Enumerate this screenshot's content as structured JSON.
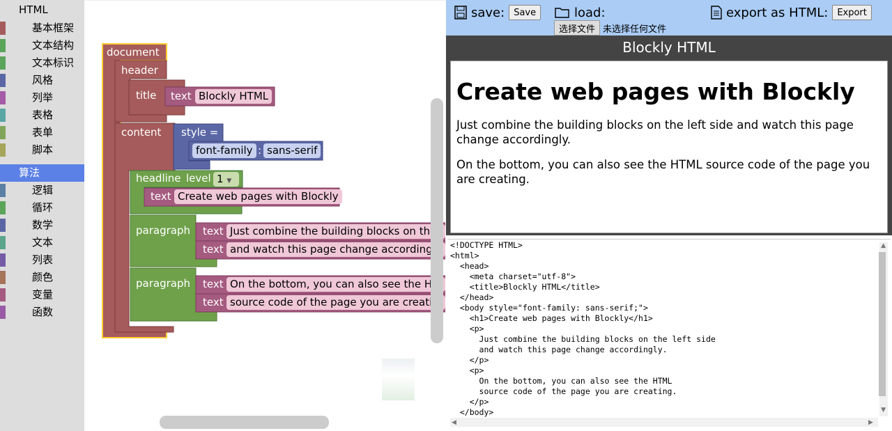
{
  "toolbox": {
    "items": [
      {
        "label": "HTML",
        "color": "",
        "type": "top"
      },
      {
        "label": "基本框架",
        "color": "#a55b5b"
      },
      {
        "label": "文本结构",
        "color": "#5ba55b"
      },
      {
        "label": "文本标识",
        "color": "#5ba55b"
      },
      {
        "label": "风格",
        "color": "#5b67a5"
      },
      {
        "label": "列举",
        "color": "#a55ba5"
      },
      {
        "label": "表格",
        "color": "#5ba5a5"
      },
      {
        "label": "表单",
        "color": "#80a55b"
      },
      {
        "label": "脚本",
        "color": "#a5a55b"
      },
      {
        "label": "算法",
        "color": "",
        "type": "selected"
      },
      {
        "label": "逻辑",
        "color": "#5b80a5"
      },
      {
        "label": "循环",
        "color": "#5ba55b"
      },
      {
        "label": "数学",
        "color": "#5b67a5"
      },
      {
        "label": "文本",
        "color": "#5ba58c"
      },
      {
        "label": "列表",
        "color": "#745ba5"
      },
      {
        "label": "颜色",
        "color": "#a5745b"
      },
      {
        "label": "变量",
        "color": "#a55b80"
      },
      {
        "label": "函数",
        "color": "#995ba5"
      }
    ]
  },
  "blocks": {
    "document": "document",
    "header": "header",
    "title": "title",
    "title_text_label": "text",
    "title_text_value": "Blockly HTML",
    "content": "content",
    "style": "style =",
    "font_family": "font-family",
    "colon": ":",
    "font_value": "sans-serif",
    "headline": "headline",
    "level_label": "level",
    "level_value": "1",
    "headline_text_label": "text",
    "headline_text_value": "Create web pages with Blockly",
    "paragraph": "paragraph",
    "p1_line1_label": "text",
    "p1_line1_value": "Just combine the building blocks on the",
    "p1_line2_label": "text",
    "p1_line2_value": "and watch this page change accordingly",
    "p2_line1_label": "text",
    "p2_line1_value": "On the bottom, you can also see the HT",
    "p2_line2_label": "text",
    "p2_line2_value": "source code of the page you are creatin"
  },
  "toolbar": {
    "save_label": "save:",
    "save_button": "Save",
    "load_label": "load:",
    "choose_file": "选择文件",
    "no_file": "未选择任何文件",
    "export_label": "export as HTML:",
    "export_button": "Export"
  },
  "panel_title": "Blockly HTML",
  "preview": {
    "heading": "Create web pages with Blockly",
    "p1": "Just combine the building blocks on the left side and watch this page change accordingly.",
    "p2": "On the bottom, you can also see the HTML source code of the page you are creating."
  },
  "source": "<!DOCTYPE HTML>\n<html>\n  <head>\n    <meta charset=\"utf-8\">\n    <title>Blockly HTML</title>\n  </head>\n  <body style=\"font-family: sans-serif;\">\n    <h1>Create web pages with Blockly</h1>\n    <p>\n      Just combine the building blocks on the left side\n      and watch this page change accordingly.\n    </p>\n    <p>\n      On the bottom, you can also see the HTML\n      source code of the page you are creating.\n    </p>\n  </body>"
}
